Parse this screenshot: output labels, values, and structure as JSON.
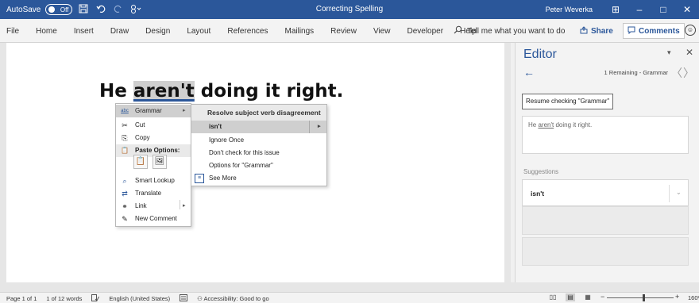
{
  "titlebar": {
    "autosave_label": "AutoSave",
    "autosave_state": "Off",
    "doc_title": "Correcting Spelling",
    "user_name": "Peter Weverka",
    "save_icon": "save-icon",
    "undo_icon": "undo-icon",
    "redo_icon": "redo-icon",
    "customize_icon": "customize-icon",
    "btn_ribbon_display": "⊞",
    "btn_minimize": "–",
    "btn_maximize": "□",
    "btn_close": "✕",
    "accent_color": "#2b579a"
  },
  "ribbon": {
    "tabs": [
      "File",
      "Home",
      "Insert",
      "Draw",
      "Design",
      "Layout",
      "References",
      "Mailings",
      "Review",
      "View",
      "Developer",
      "Help"
    ],
    "tellme": "Tell me what you want to do",
    "share": "Share",
    "comments": "Comments",
    "smiley": "☺"
  },
  "document": {
    "text_before": "He ",
    "text_error": "aren't",
    "text_after": " doing it right."
  },
  "context_menu": {
    "items": [
      {
        "label": "Grammar",
        "icon": "abc",
        "arrow": "▸"
      },
      {
        "label": "Cut",
        "icon": "✂"
      },
      {
        "label": "Copy",
        "icon": "⎘"
      },
      {
        "label": "Paste Options:",
        "icon": "📋"
      },
      {
        "label": "Smart Lookup",
        "icon": "⌕"
      },
      {
        "label": "Translate",
        "icon": "⇄"
      },
      {
        "label": "Link",
        "icon": "⚭",
        "arrow": "▸"
      },
      {
        "label": "New Comment",
        "icon": "✎"
      }
    ],
    "paste_icons": [
      "📋",
      "🖼"
    ]
  },
  "submenu": {
    "header": "Resolve subject verb disagreement",
    "items": [
      {
        "label": "isn't",
        "arrow": "▸"
      },
      {
        "label": "Ignore Once"
      },
      {
        "label": "Don't check for this issue"
      },
      {
        "label": "Options for \"Grammar\""
      },
      {
        "label": "See More",
        "icon": "≡"
      }
    ]
  },
  "editor": {
    "title": "Editor",
    "pin": "▾",
    "close": "✕",
    "back": "←",
    "remaining": "1 Remaining - Grammar",
    "prev": "〈",
    "next": "〉",
    "resume": "Resume checking \"Grammar\"",
    "context_before": "He ",
    "context_error": "aren't",
    "context_after": " doing it right.",
    "suggestions_label": "Suggestions",
    "suggestion": "isn't",
    "suggestion_chevron": "⌄"
  },
  "statusbar": {
    "page": "Page 1 of 1",
    "words": "1 of 12 words",
    "proofing_icon": "proofing-icon",
    "language": "English (United States)",
    "macro_icon": "macro-icon",
    "accessibility": "Accessibility: Good to go",
    "zoom": "160%",
    "zoom_level_percent": 160
  }
}
